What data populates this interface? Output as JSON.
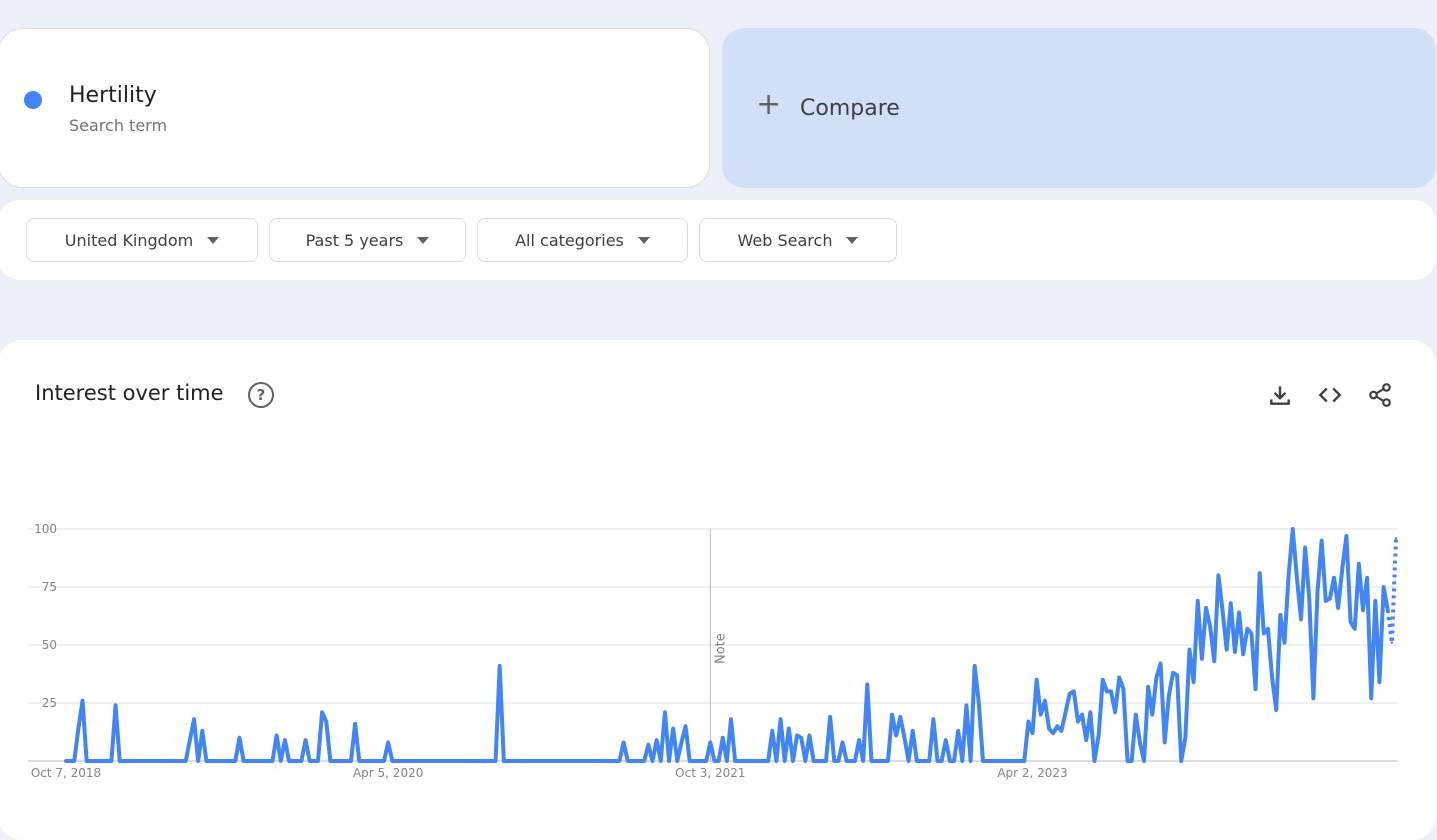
{
  "search_term": {
    "name": "Hertility",
    "subtitle": "Search term",
    "color": "#4285f4"
  },
  "compare": {
    "plus": "+",
    "label": "Compare"
  },
  "filters": [
    {
      "label": "United Kingdom"
    },
    {
      "label": "Past 5 years"
    },
    {
      "label": "All categories"
    },
    {
      "label": "Web Search"
    }
  ],
  "card": {
    "title": "Interest over time",
    "help": "?"
  },
  "icons": [
    "download-icon",
    "embed-icon",
    "share-icon"
  ],
  "chart_data": {
    "type": "line",
    "title": "Interest over time",
    "x_tick_labels": [
      "Oct 7, 2018",
      "Apr 5, 2020",
      "Oct 3, 2021",
      "Apr 2, 2023"
    ],
    "y_ticks": [
      25,
      50,
      75,
      100
    ],
    "ylim": [
      0,
      100
    ],
    "grid": true,
    "annotation": {
      "label": "Note",
      "at_week_index": 156
    },
    "series": [
      {
        "color": "#4285f4",
        "partial_last_points": 2,
        "values": [
          0,
          0,
          0,
          14,
          26,
          0,
          0,
          0,
          0,
          0,
          0,
          0,
          24,
          0,
          0,
          0,
          0,
          0,
          0,
          0,
          0,
          0,
          0,
          0,
          0,
          0,
          0,
          0,
          0,
          0,
          9,
          18,
          0,
          13,
          0,
          0,
          0,
          0,
          0,
          0,
          0,
          0,
          10,
          0,
          0,
          0,
          0,
          0,
          0,
          0,
          0,
          11,
          0,
          9,
          0,
          0,
          0,
          0,
          9,
          0,
          0,
          0,
          21,
          17,
          0,
          0,
          0,
          0,
          0,
          0,
          16,
          0,
          0,
          0,
          0,
          0,
          0,
          0,
          8,
          0,
          0,
          0,
          0,
          0,
          0,
          0,
          0,
          0,
          0,
          0,
          0,
          0,
          0,
          0,
          0,
          0,
          0,
          0,
          0,
          0,
          0,
          0,
          0,
          0,
          0,
          41,
          0,
          0,
          0,
          0,
          0,
          0,
          0,
          0,
          0,
          0,
          0,
          0,
          0,
          0,
          0,
          0,
          0,
          0,
          0,
          0,
          0,
          0,
          0,
          0,
          0,
          0,
          0,
          0,
          0,
          8,
          0,
          0,
          0,
          0,
          0,
          7,
          0,
          9,
          0,
          21,
          0,
          14,
          0,
          8,
          15,
          0,
          0,
          0,
          0,
          0,
          8,
          0,
          0,
          10,
          0,
          18,
          0,
          0,
          0,
          0,
          0,
          0,
          0,
          0,
          0,
          13,
          0,
          18,
          0,
          14,
          0,
          11,
          10,
          0,
          11,
          0,
          0,
          0,
          0,
          19,
          0,
          0,
          8,
          0,
          0,
          0,
          9,
          0,
          33,
          0,
          0,
          0,
          0,
          0,
          20,
          11,
          19,
          10,
          0,
          13,
          0,
          0,
          0,
          0,
          18,
          0,
          0,
          9,
          0,
          0,
          13,
          0,
          24,
          0,
          41,
          25,
          0,
          0,
          0,
          0,
          0,
          0,
          0,
          0,
          0,
          0,
          0,
          17,
          12,
          35,
          20,
          26,
          14,
          12,
          15,
          13,
          21,
          29,
          30,
          17,
          20,
          9,
          21,
          0,
          11,
          35,
          30,
          30,
          21,
          36,
          31,
          0,
          0,
          20,
          8,
          0,
          32,
          20,
          36,
          42,
          8,
          28,
          38,
          37,
          0,
          10,
          48,
          34,
          69,
          44,
          66,
          58,
          43,
          80,
          65,
          48,
          68,
          47,
          64,
          46,
          57,
          55,
          31,
          81,
          55,
          57,
          36,
          22,
          63,
          51,
          80,
          100,
          79,
          61,
          92,
          70,
          27,
          73,
          95,
          69,
          70,
          79,
          66,
          83,
          97,
          60,
          57,
          85,
          65,
          79,
          27,
          69,
          34,
          75,
          65,
          51,
          96
        ]
      }
    ]
  }
}
